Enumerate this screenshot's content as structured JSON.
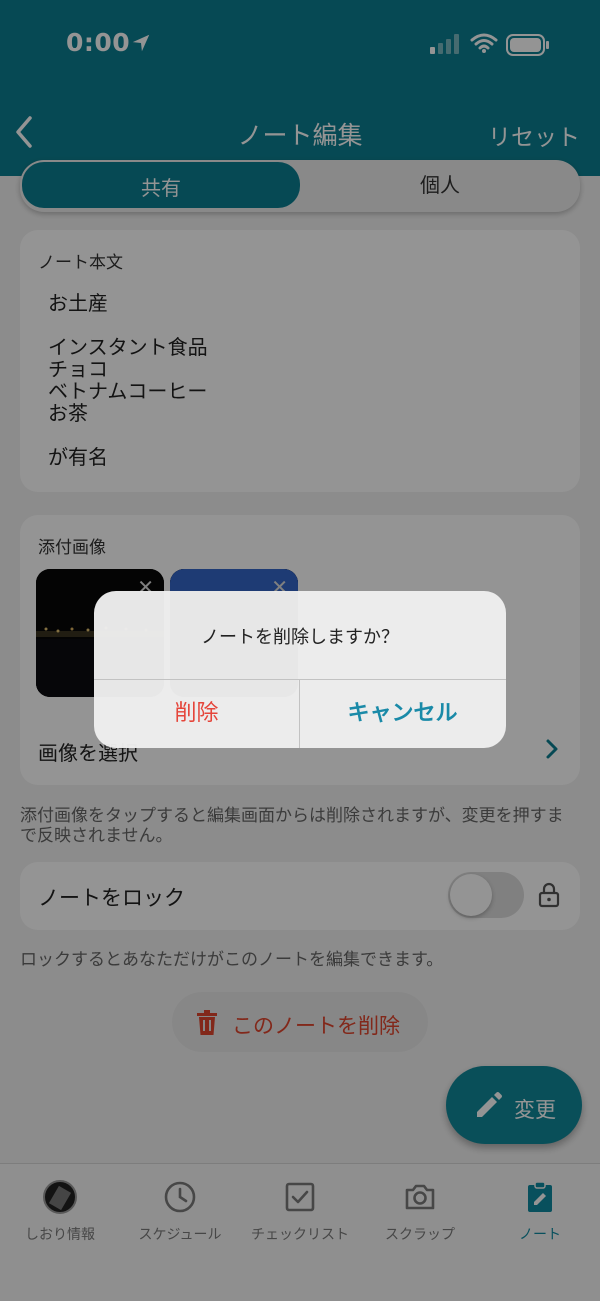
{
  "status_bar": {
    "time": "0:00"
  },
  "header": {
    "title": "ノート編集",
    "reset_label": "リセット"
  },
  "segment": {
    "shared_label": "共有",
    "personal_label": "個人"
  },
  "note": {
    "section_label": "ノート本文",
    "lines": [
      "お土産",
      "",
      "インスタント食品",
      "チョコ",
      "ベトナムコーヒー",
      "お茶",
      "",
      "が有名"
    ]
  },
  "attachments": {
    "section_label": "添付画像",
    "close_glyph": "✕",
    "select_label": "画像を選択"
  },
  "hints": {
    "attachment_hint": "添付画像をタップすると編集画面からは削除されますが、変更を押すまで反映されません。",
    "lock_hint": "ロックするとあなただけがこのノートを編集できます。"
  },
  "lock": {
    "label": "ノートをロック",
    "enabled": false
  },
  "delete_note_label": "このノートを削除",
  "fab_label": "変更",
  "tabs": [
    {
      "label": "しおり情報",
      "icon": "avatar"
    },
    {
      "label": "スケジュール",
      "icon": "clock-icon"
    },
    {
      "label": "チェックリスト",
      "icon": "checkbox-icon"
    },
    {
      "label": "スクラップ",
      "icon": "camera-icon"
    },
    {
      "label": "ノート",
      "icon": "clipboard-edit-icon",
      "active": true
    }
  ],
  "dialog": {
    "message": "ノートを削除しますか？",
    "delete_label": "削除",
    "cancel_label": "キャンセル"
  },
  "colors": {
    "accent": "#0c7f91",
    "destructive": "#e5453a",
    "tab_active": "#0e8aa0"
  }
}
